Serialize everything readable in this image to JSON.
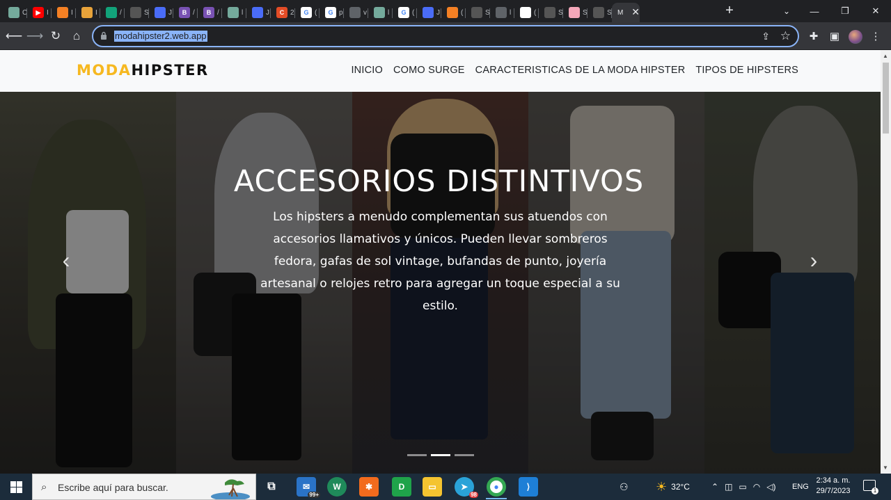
{
  "browser": {
    "tabs": [
      {
        "icon": "chatgpt-icon",
        "color": "#74aa9c",
        "glyph": "",
        "title": "C"
      },
      {
        "icon": "youtube-icon",
        "color": "#ff0000",
        "glyph": "▶",
        "title": "I"
      },
      {
        "icon": "stackoverflow-icon",
        "color": "#f48024",
        "glyph": "",
        "title": "I"
      },
      {
        "icon": "keepcoding-icon",
        "color": "#e8a33a",
        "glyph": "",
        "title": "I"
      },
      {
        "icon": "wave-icon",
        "color": "#12a37a",
        "glyph": "",
        "title": "/"
      },
      {
        "icon": "soet-icon",
        "color": "#555",
        "glyph": "",
        "title": "S"
      },
      {
        "icon": "app-icon",
        "color": "#4a6cf7",
        "glyph": "",
        "title": "J"
      },
      {
        "icon": "bootstrap-icon",
        "color": "#7952b3",
        "glyph": "B",
        "title": "/"
      },
      {
        "icon": "bootstrap-icon",
        "color": "#7952b3",
        "glyph": "B",
        "title": "/"
      },
      {
        "icon": "chatgpt-icon",
        "color": "#74aa9c",
        "glyph": "",
        "title": "l"
      },
      {
        "icon": "app-icon",
        "color": "#4a6cf7",
        "glyph": "",
        "title": "J"
      },
      {
        "icon": "codecademy-icon",
        "color": "#e34c26",
        "glyph": "C",
        "title": "2"
      },
      {
        "icon": "google-icon",
        "color": "#ffffff",
        "glyph": "G",
        "title": "("
      },
      {
        "icon": "google-icon",
        "color": "#ffffff",
        "glyph": "G",
        "title": "p"
      },
      {
        "icon": "globe-icon",
        "color": "#5f6368",
        "glyph": "",
        "title": "v"
      },
      {
        "icon": "chatgpt-icon",
        "color": "#74aa9c",
        "glyph": "",
        "title": "l"
      },
      {
        "icon": "google-icon",
        "color": "#ffffff",
        "glyph": "G",
        "title": "("
      },
      {
        "icon": "app-icon",
        "color": "#4a6cf7",
        "glyph": "",
        "title": "J"
      },
      {
        "icon": "stackoverflow-icon",
        "color": "#f48024",
        "glyph": "",
        "title": "("
      },
      {
        "icon": "soet-icon",
        "color": "#555",
        "glyph": "",
        "title": "S"
      },
      {
        "icon": "globe-icon",
        "color": "#5f6368",
        "glyph": "",
        "title": "l"
      },
      {
        "icon": "github-icon",
        "color": "#ffffff",
        "glyph": "",
        "title": "("
      },
      {
        "icon": "soet-icon",
        "color": "#555",
        "glyph": "",
        "title": "S"
      },
      {
        "icon": "image-icon",
        "color": "#f4a7b9",
        "glyph": "",
        "title": "S"
      },
      {
        "icon": "soet-icon",
        "color": "#555",
        "glyph": "",
        "title": "S"
      }
    ],
    "active_tab": {
      "title": "M"
    },
    "url": "modahipster2.web.app"
  },
  "site": {
    "brand_part1": "MODA",
    "brand_part2": "HIPSTER",
    "nav": [
      "INICIO",
      "COMO SURGE",
      "CARACTERISTICAS DE LA MODA HIPSTER",
      "TIPOS DE HIPSTERS"
    ],
    "slide": {
      "title": "ACCESORIOS DISTINTIVOS",
      "text": "Los hipsters a menudo complementan sus atuendos con accesorios llamativos y únicos. Pueden llevar sombreros fedora, gafas de sol vintage, bufandas de punto, joyería artesanal o relojes retro para agregar un toque especial a su estilo.",
      "prev": "‹",
      "next": "›",
      "indicators": 3,
      "active_indicator": 1
    }
  },
  "taskbar": {
    "search_placeholder": "Escribe aquí para buscar.",
    "mail_badge": "99+",
    "telegram_badge": "98",
    "temperature": "32°C",
    "language": "ENG",
    "time": "2:34 a. m.",
    "date": "29/7/2023",
    "notifications": "1"
  }
}
